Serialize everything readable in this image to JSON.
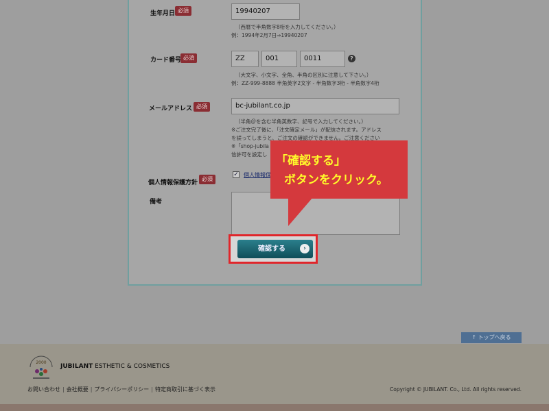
{
  "form": {
    "birthdate": {
      "label": "生年月日",
      "required": "必須",
      "value": "19940207",
      "hint1": "（西暦で半角数字8桁を入力してください。）",
      "hint2": "例：1994年2月7日⇒19940207"
    },
    "card_number": {
      "label": "カード番号",
      "required": "必須",
      "part1": "ZZ",
      "part2": "001",
      "part3": "0011",
      "help_icon": "?",
      "hint1": "（大文字、小文字、全角、半角の区別に注意して下さい。）",
      "hint2": "例：ZZ-999-8888 半角英字2文字 - 半角数字3桁 - 半角数字4桁"
    },
    "email": {
      "label": "メールアドレス",
      "required": "必須",
      "value": "bc-jubilant.co.jp",
      "hint1": "（半角＠を含む半角英数字、記号で入力してください。）",
      "hint2": "※ご注文完了後に、「注文確定メール」が配信されます。アドレス",
      "hint3": "を誤ってしまうと、ご注文の確認ができません。ご注意ください",
      "hint4": "※「shop-jubila",
      "hint5": "信許可を設定し"
    },
    "privacy": {
      "label": "個人情報保護方針",
      "required": "必須",
      "check": "✓",
      "link": "個人情報保"
    },
    "remarks": {
      "label": "備考"
    },
    "confirm_button": "確認する",
    "confirm_arrow": "›"
  },
  "callout": {
    "line1": "「確認する」",
    "line2": "ボタンをクリック。"
  },
  "to_top": "↑ トップへ戻る",
  "footer": {
    "logo_text": "2000",
    "brand_bold": "JUBILANT",
    "brand_rest": " ESTHETIC & COSMETICS",
    "links": [
      "お問い合わせ",
      "会社概要",
      "プライバシーポリシー",
      "特定商取引に基づく表示"
    ],
    "separator": "|",
    "copyright": "Copyright © JUBILANT. Co., Ltd. All rights reserved."
  },
  "colors": {
    "required_badge": "#8a2d33",
    "button": "#0f4e59",
    "callout_bg": "#d4393d",
    "callout_text": "#fffb2a",
    "highlight_border": "#e0262b"
  }
}
